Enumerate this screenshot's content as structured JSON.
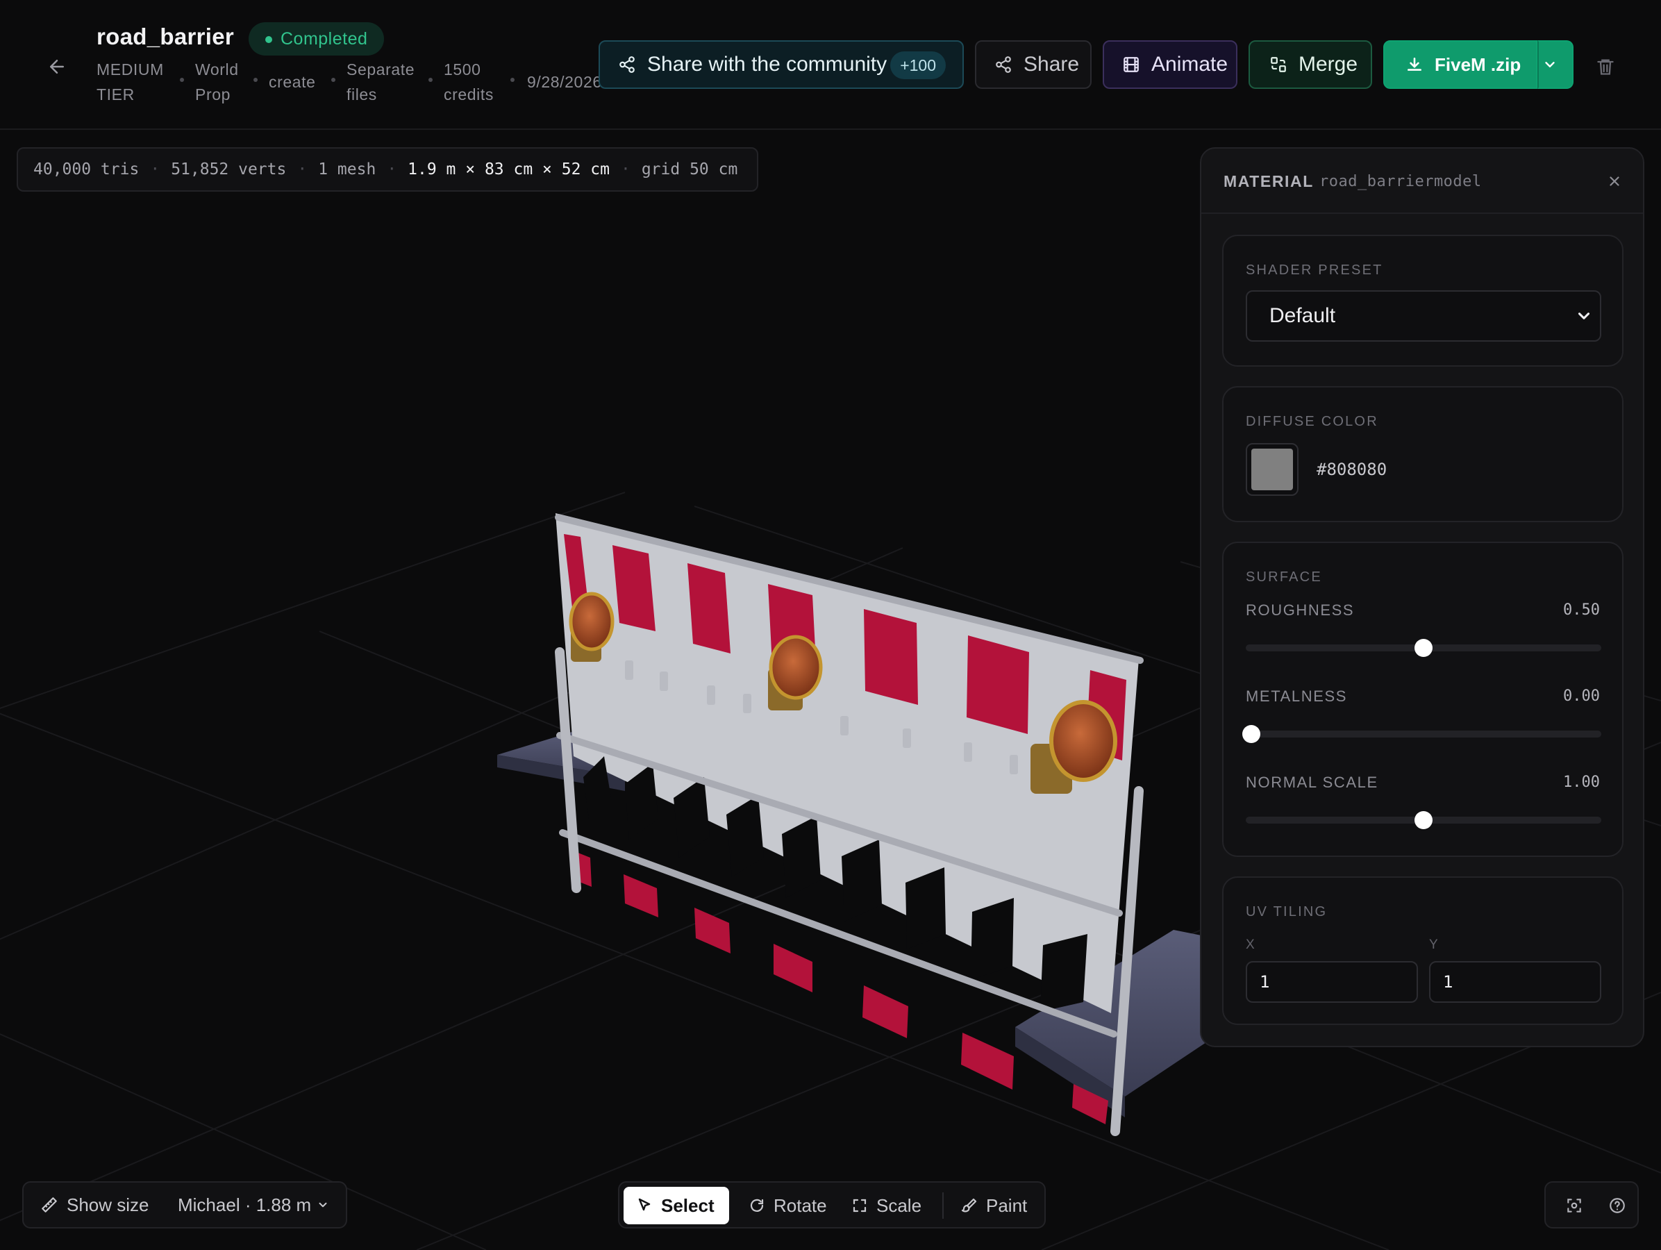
{
  "header": {
    "title": "road_barrier",
    "status": "Completed",
    "meta": [
      "MEDIUM TIER",
      "World Prop",
      "create",
      "Separate files",
      "1500 credits",
      "9/28/2026"
    ],
    "buttons": {
      "community": "Share with the community",
      "community_count": "+100",
      "share": "Share",
      "animate": "Animate",
      "merge": "Merge",
      "download": "FiveM .zip"
    }
  },
  "stats": {
    "tris": "40,000 tris",
    "verts": "51,852 verts",
    "mesh": "1 mesh",
    "dimensions": "1.9 m × 83 cm × 52 cm",
    "grid": "grid 50 cm"
  },
  "material_panel": {
    "label": "MATERIAL",
    "name": "road_barriermodel",
    "shader_preset": {
      "label": "SHADER PRESET",
      "value": "Default",
      "options": [
        "Default"
      ]
    },
    "diffuse": {
      "label": "DIFFUSE COLOR",
      "hex": "#808080"
    },
    "surface": {
      "label": "SURFACE",
      "roughness": {
        "label": "ROUGHNESS",
        "display": "0.50",
        "value": 0.5
      },
      "metalness": {
        "label": "METALNESS",
        "display": "0.00",
        "value": 0.0
      },
      "normal_scale": {
        "label": "NORMAL SCALE",
        "display": "1.00",
        "value": 0.5
      }
    },
    "uv_tiling": {
      "label": "UV TILING",
      "x_label": "X",
      "y_label": "Y",
      "x": "1",
      "y": "1"
    }
  },
  "bottom": {
    "show_size": "Show size",
    "reference": "Michael · 1.88 m",
    "tools": {
      "select": "Select",
      "rotate": "Rotate",
      "scale": "Scale",
      "paint": "Paint"
    }
  },
  "colors": {
    "accent_green": "#0f9b6c",
    "status_green": "#31c48d",
    "barrier_red": "#b3123a",
    "barrier_white": "#c7c9cf",
    "lamp_orange": "#b0542a"
  }
}
